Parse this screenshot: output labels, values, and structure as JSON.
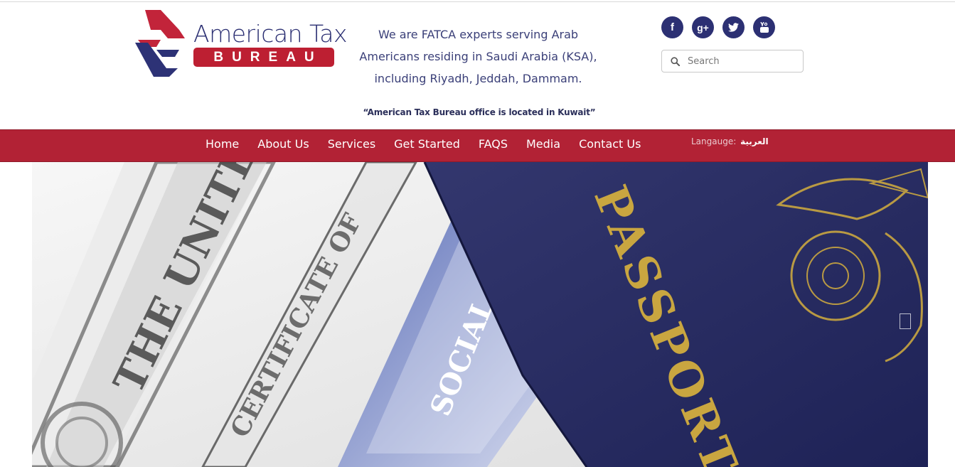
{
  "header": {
    "logo": {
      "title": "American Tax",
      "subtitle": "BUREAU"
    },
    "tagline": "We are FATCA experts serving Arab Americans residing in Saudi Arabia (KSA), including Riyadh, Jeddah, Dammam.",
    "kuwait_note": "“American Tax Bureau office is located in Kuwait”",
    "socials": [
      {
        "icon": "facebook-icon",
        "glyph": "f"
      },
      {
        "icon": "google-plus-icon",
        "glyph": "g+"
      },
      {
        "icon": "twitter-icon",
        "glyph": ""
      },
      {
        "icon": "youtube-icon",
        "glyph": ""
      }
    ],
    "search": {
      "placeholder": "Search",
      "value": ""
    }
  },
  "nav": {
    "items": [
      "Home",
      "About Us",
      "Services",
      "Get Started",
      "FAQS",
      "Media",
      "Contact Us"
    ],
    "language_label": "Langauge:",
    "language_link": "العربية"
  },
  "hero": {
    "passport_text": "PASSPORT",
    "card_text": "SOCIAL SECU",
    "certificate_text": "THE UNITED",
    "bond_text": "CERTIFICATE OF"
  },
  "colors": {
    "brand_navy": "#2c3073",
    "brand_red": "#bd1f32",
    "nav_red": "#b22235",
    "passport_blue": "#272b62",
    "gold": "#c9a640"
  }
}
